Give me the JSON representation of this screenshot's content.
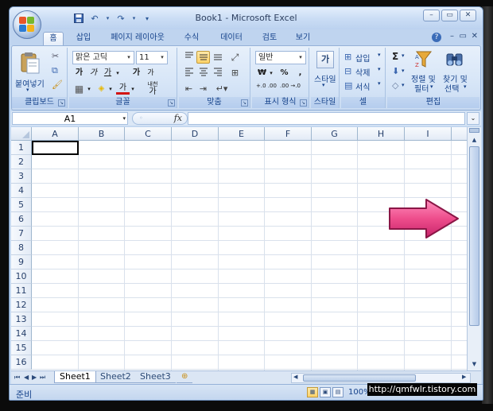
{
  "window": {
    "title": "Book1 - Microsoft Excel",
    "controls": {
      "minimize": "–",
      "restore": "▭",
      "close": "✕"
    }
  },
  "quick_access": {
    "save": "💾",
    "undo": "↶",
    "redo": "↷",
    "customize": "▾"
  },
  "ribbon_tabs": [
    {
      "label": "홈",
      "active": true
    },
    {
      "label": "삽입",
      "active": false
    },
    {
      "label": "페이지 레이아웃",
      "active": false
    },
    {
      "label": "수식",
      "active": false
    },
    {
      "label": "데이터",
      "active": false
    },
    {
      "label": "검토",
      "active": false
    },
    {
      "label": "보기",
      "active": false
    }
  ],
  "ribbon": {
    "help": "?",
    "clipboard": {
      "label": "클립보드",
      "paste": "붙여넣기"
    },
    "font": {
      "label": "글꼴",
      "font_name": "맑은 고딕",
      "font_size": "11",
      "bold": "가",
      "italic": "가",
      "underline": "가",
      "grow": "가",
      "shrink": "가",
      "font_color_glyph": "가",
      "phonetic_top": "내천",
      "phonetic_bottom": "가"
    },
    "alignment": {
      "label": "맞춤"
    },
    "number": {
      "label": "표시 형식",
      "format": "일반",
      "currency": "₩",
      "percent": "%",
      "comma": ",",
      "inc_decimal": "+.0 .00",
      "dec_decimal": ".00 →.0"
    },
    "styles": {
      "label": "스타일",
      "button": "스타일",
      "icon_glyph": "가"
    },
    "cells": {
      "label": "셀",
      "insert": "삽입",
      "delete": "삭제",
      "format": "서식"
    },
    "editing": {
      "label": "편집",
      "sigma": "Σ",
      "sort_filter_line1": "정렬 및",
      "sort_filter_line2": "필터",
      "find_select_line1": "찾기 및",
      "find_select_line2": "선택"
    }
  },
  "formula_bar": {
    "name_box": "A1",
    "fx": "fx",
    "value": ""
  },
  "grid": {
    "columns": [
      "A",
      "B",
      "C",
      "D",
      "E",
      "F",
      "G",
      "H",
      "I"
    ],
    "rows": [
      "1",
      "2",
      "3",
      "4",
      "5",
      "6",
      "7",
      "8",
      "9",
      "10",
      "11",
      "12",
      "13",
      "14",
      "15",
      "16"
    ],
    "selected_cell": "A1"
  },
  "sheet_tabs": [
    {
      "label": "Sheet1",
      "active": true
    },
    {
      "label": "Sheet2",
      "active": false
    },
    {
      "label": "Sheet3",
      "active": false
    }
  ],
  "status_bar": {
    "ready": "준비",
    "zoom": "100%"
  },
  "watermark": "http://qmfwlr.tistory.com",
  "colors": {
    "annotation_arrow": "#ee4d8c",
    "ribbon_text": "#15428b"
  }
}
